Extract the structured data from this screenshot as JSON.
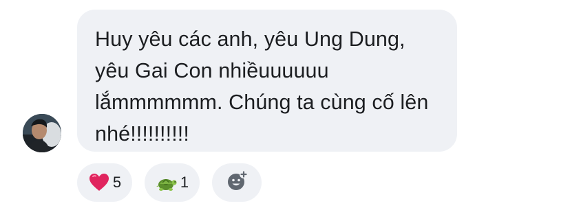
{
  "message": {
    "text": "Huy yêu các anh, yêu Ung Dung, yêu Gai Con nhiềuuuuuu lắmmmmmm. Chúng ta cùng cố lên nhé!!!!!!!!!!"
  },
  "reactions": [
    {
      "icon": "red-heart-icon",
      "count": "5",
      "color": "#e0245e"
    },
    {
      "icon": "turtle-icon",
      "count": "1",
      "color": "#6fa13a"
    }
  ],
  "add_reaction": {
    "icon": "add-reaction-smiley-icon"
  },
  "colors": {
    "bubble_bg": "#eff1f5",
    "text": "#1c1e21",
    "icon_gray": "#606770"
  }
}
